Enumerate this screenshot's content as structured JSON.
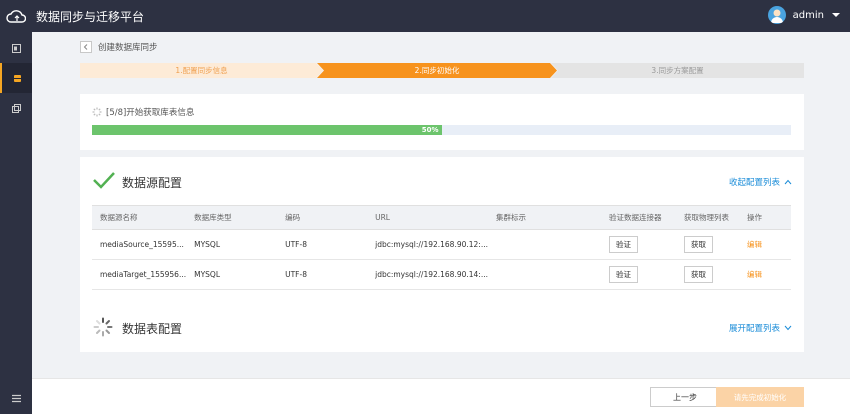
{
  "header": {
    "title": "数据同步与迁移平台",
    "user_name": "admin"
  },
  "breadcrumb": {
    "text": "创建数据库同步"
  },
  "steps": [
    {
      "label": "1.配置同步信息",
      "state": "done"
    },
    {
      "label": "2.同步初始化",
      "state": "active"
    },
    {
      "label": "3.同步方案配置",
      "state": "pending"
    }
  ],
  "progress": {
    "label": "[5/8]开始获取库表信息",
    "percent": 50,
    "percent_text": "50%"
  },
  "source_config": {
    "title": "数据源配置",
    "toggle_label": "收起配置列表",
    "columns": [
      "数据源名称",
      "数据库类型",
      "编码",
      "URL",
      "集群标示",
      "验证数据连接器",
      "获取物理列表",
      "操作"
    ],
    "rows": [
      {
        "name": "mediaSource_15595...",
        "db_type": "MYSQL",
        "encoding": "UTF-8",
        "url": "jdbc:mysql://192.168.90.12:...",
        "cluster": "",
        "verify": "验证",
        "fetch": "获取",
        "action": "编辑"
      },
      {
        "name": "mediaTarget_155956...",
        "db_type": "MYSQL",
        "encoding": "UTF-8",
        "url": "jdbc:mysql://192.168.90.14:...",
        "cluster": "",
        "verify": "验证",
        "fetch": "获取",
        "action": "编辑"
      }
    ]
  },
  "table_config": {
    "title": "数据表配置",
    "toggle_label": "展开配置列表"
  },
  "footer": {
    "prev_label": "上一步",
    "next_label": "请先完成初始化"
  },
  "colors": {
    "accent": "#f7931d",
    "progress": "#6cc46c",
    "link": "#1a8cd8",
    "dark": "#2d3142"
  }
}
